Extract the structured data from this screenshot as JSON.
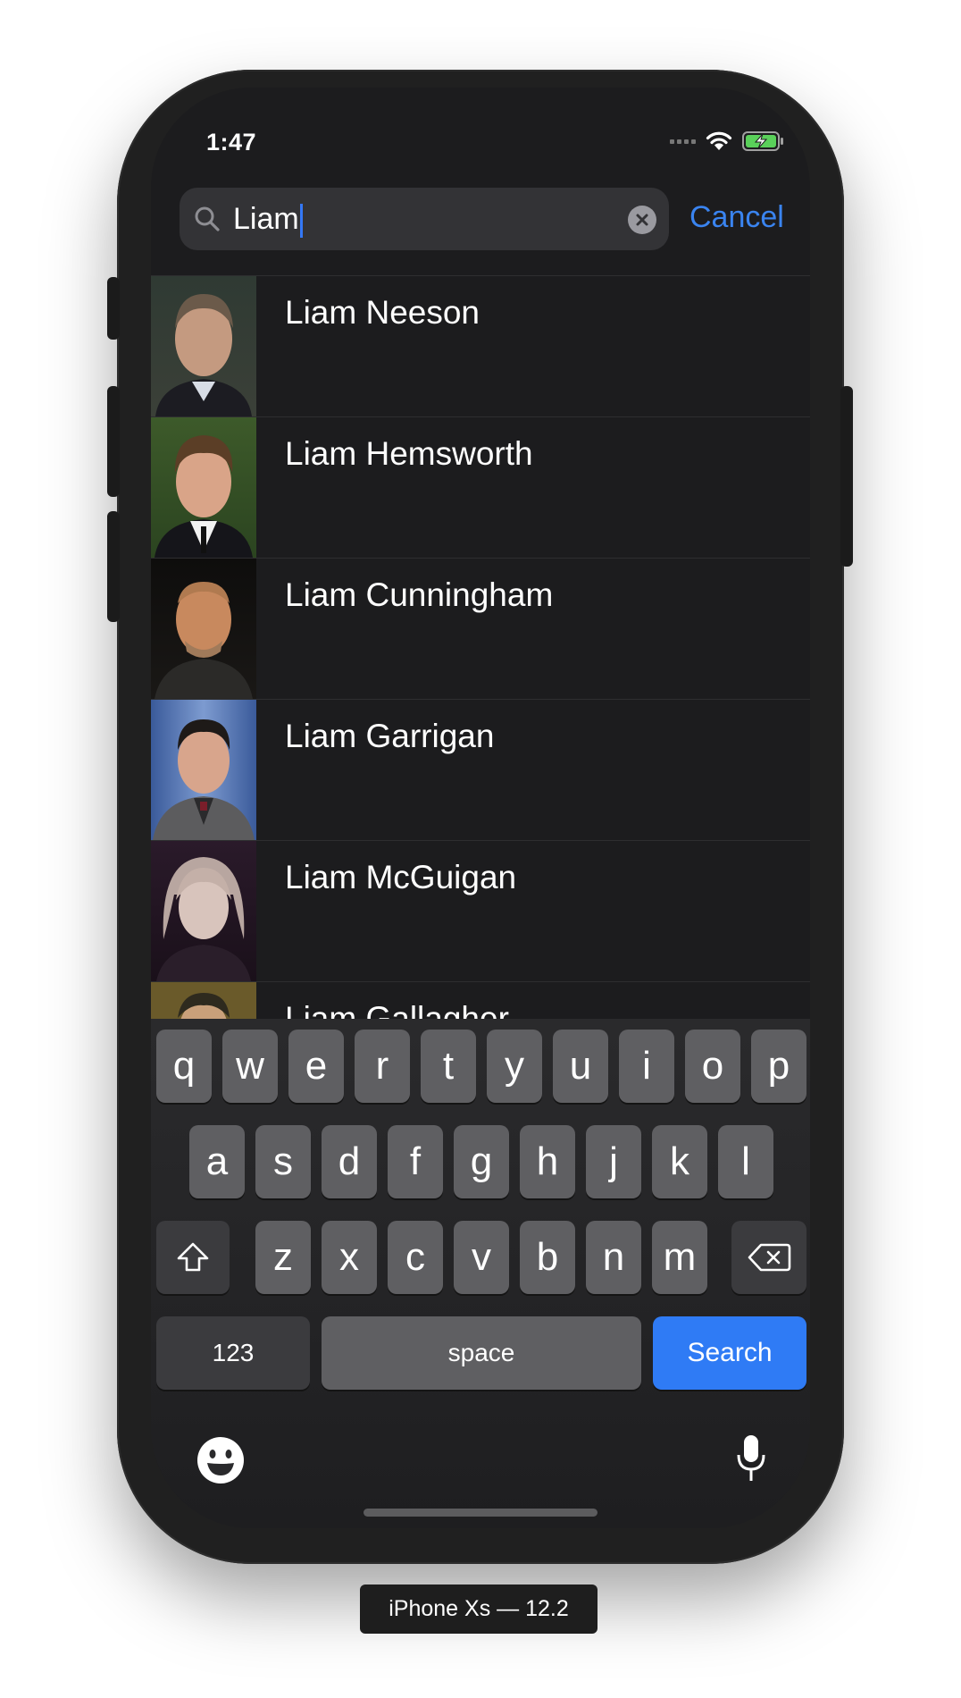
{
  "status_bar": {
    "time": "1:47"
  },
  "search": {
    "query": "Liam",
    "cancel_label": "Cancel"
  },
  "results": [
    {
      "name": "Liam Neeson"
    },
    {
      "name": "Liam Hemsworth"
    },
    {
      "name": "Liam Cunningham"
    },
    {
      "name": "Liam Garrigan"
    },
    {
      "name": "Liam McGuigan"
    },
    {
      "name": "Liam Gallagher"
    }
  ],
  "keyboard": {
    "row1": [
      "q",
      "w",
      "e",
      "r",
      "t",
      "y",
      "u",
      "i",
      "o",
      "p"
    ],
    "row2": [
      "a",
      "s",
      "d",
      "f",
      "g",
      "h",
      "j",
      "k",
      "l"
    ],
    "row3": [
      "z",
      "x",
      "c",
      "v",
      "b",
      "n",
      "m"
    ],
    "numbers_label": "123",
    "space_label": "space",
    "search_label": "Search",
    "icons": {
      "shift": "shift-icon",
      "delete": "delete-icon",
      "emoji": "emoji-icon",
      "mic": "microphone-icon"
    }
  },
  "device_label": "iPhone Xs — 12.2",
  "colors": {
    "accent": "#3a84f0",
    "search_key": "#2f7bf5",
    "battery": "#5ad05a"
  }
}
